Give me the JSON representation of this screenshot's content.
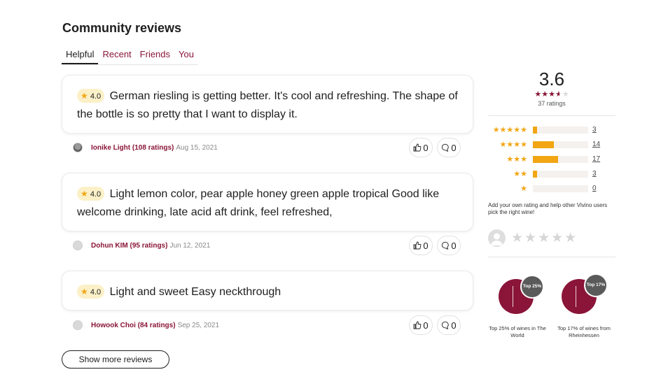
{
  "section_title": "Community reviews",
  "tabs": [
    "Helpful",
    "Recent",
    "Friends",
    "You"
  ],
  "reviews": [
    {
      "rating": "4.0",
      "text": "German riesling is getting better. It's cool and refreshing. The shape of the bottle is so pretty that I want to display it.",
      "user": "Ionike Light (108 ratings)",
      "date": "Aug 15, 2021",
      "likes": "0",
      "comments": "0"
    },
    {
      "rating": "4.0",
      "text": "Light lemon color, pear apple honey green apple tropical Good like welcome drinking, late acid aft drink, feel refreshed,",
      "user": "Dohun KIM (95 ratings)",
      "date": "Jun 12, 2021",
      "likes": "0",
      "comments": "0"
    },
    {
      "rating": "4.0",
      "text": "Light and sweet Easy neckthrough",
      "user": "Howook Choi (84 ratings)",
      "date": "Sep 25, 2021",
      "likes": "0",
      "comments": "0"
    }
  ],
  "show_more": "Show more reviews",
  "summary": {
    "average": "3.6",
    "average_value": 3.6,
    "ratings_count": "37 ratings",
    "distribution": [
      {
        "stars": 5,
        "count": "3",
        "fraction": 0.081
      },
      {
        "stars": 4,
        "count": "14",
        "fraction": 0.378
      },
      {
        "stars": 3,
        "count": "17",
        "fraction": 0.459
      },
      {
        "stars": 2,
        "count": "3",
        "fraction": 0.081
      },
      {
        "stars": 1,
        "count": "0",
        "fraction": 0.0
      }
    ],
    "add_rating_text": "Add your own rating and help other Vivino users pick the right wine!"
  },
  "rank_badges": [
    {
      "bubble": "Top 25%",
      "label": "Top 25% of wines in The World"
    },
    {
      "bubble": "Top 17%",
      "label": "Top 17% of wines from Rheinhessen"
    }
  ],
  "colors": {
    "accent": "#8a1538",
    "star": "#f2a613",
    "star_badge_bg": "#fbf0c8"
  },
  "icons": [
    "star-icon",
    "thumbs-up-icon",
    "comment-icon",
    "user-avatar-icon"
  ]
}
